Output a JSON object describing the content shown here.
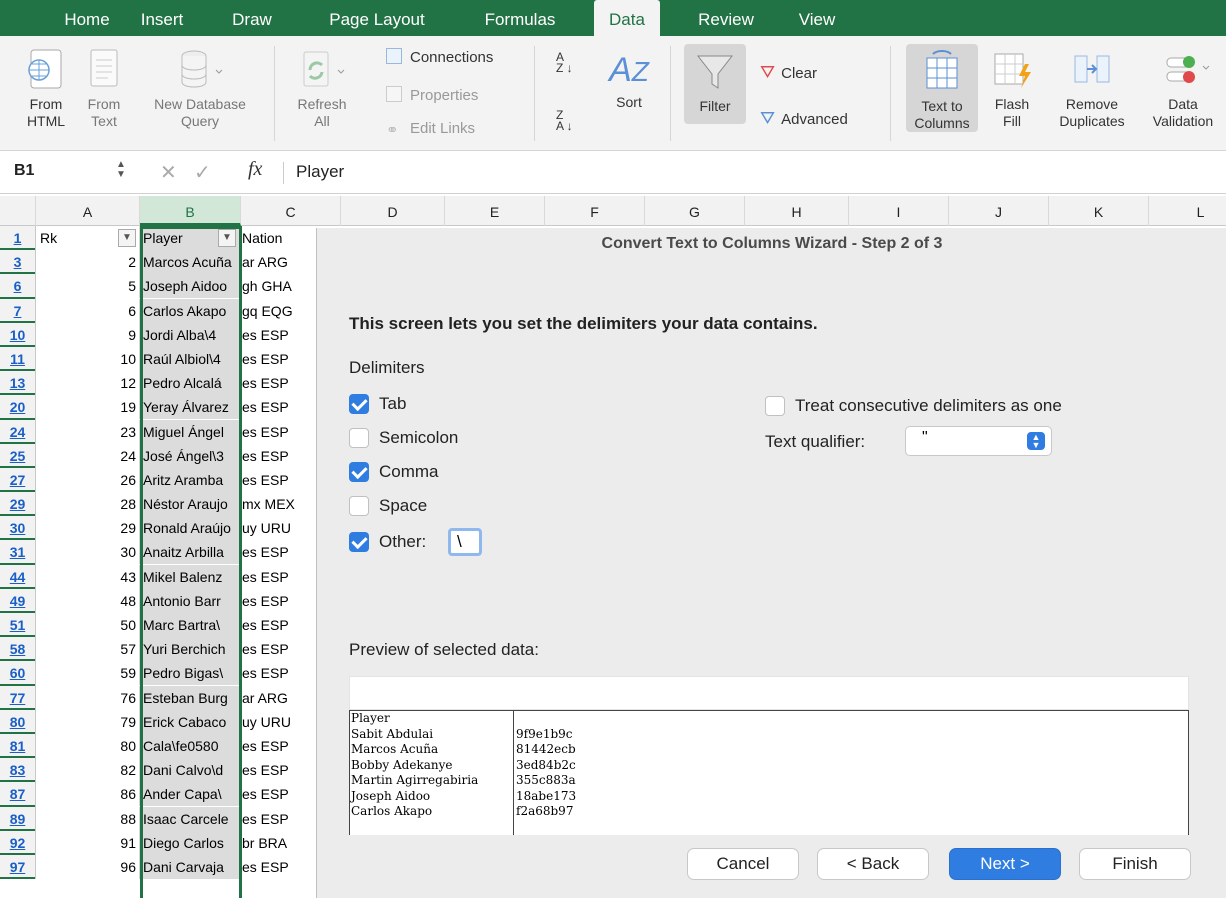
{
  "tabs": [
    "Home",
    "Insert",
    "Draw",
    "Page Layout",
    "Formulas",
    "Data",
    "Review",
    "View"
  ],
  "ribbon": {
    "from_html": [
      "From",
      "HTML"
    ],
    "from_text": [
      "From",
      "Text"
    ],
    "new_db": [
      "New Database",
      "Query"
    ],
    "refresh": [
      "Refresh",
      "All"
    ],
    "connections": "Connections",
    "properties": "Properties",
    "edit_links": "Edit Links",
    "sort": "Sort",
    "filter": "Filter",
    "clear": "Clear",
    "advanced": "Advanced",
    "text_to_columns": [
      "Text to",
      "Columns"
    ],
    "flash_fill": [
      "Flash",
      "Fill"
    ],
    "remove_dup": [
      "Remove",
      "Duplicates"
    ],
    "data_validation": [
      "Data",
      "Validation"
    ]
  },
  "formula_bar": {
    "cell_ref": "B1",
    "fx": "fx",
    "value": "Player"
  },
  "columns": [
    "A",
    "B",
    "C",
    "D",
    "E",
    "F",
    "G",
    "H",
    "I",
    "J",
    "K",
    "L"
  ],
  "rows": [
    {
      "n": "1",
      "a": "Rk",
      "b": "Player",
      "c": "Nation"
    },
    {
      "n": "3",
      "a": "2",
      "b": "Marcos Acuña",
      "c": "ar ARG"
    },
    {
      "n": "6",
      "a": "5",
      "b": "Joseph Aidoo",
      "c": "gh GHA"
    },
    {
      "n": "7",
      "a": "6",
      "b": "Carlos Akapo",
      "c": "gq EQG"
    },
    {
      "n": "10",
      "a": "9",
      "b": "Jordi Alba\\4",
      "c": "es ESP"
    },
    {
      "n": "11",
      "a": "10",
      "b": "Raúl Albiol\\4",
      "c": "es ESP"
    },
    {
      "n": "13",
      "a": "12",
      "b": "Pedro Alcalá",
      "c": "es ESP"
    },
    {
      "n": "20",
      "a": "19",
      "b": "Yeray Álvarez",
      "c": "es ESP"
    },
    {
      "n": "24",
      "a": "23",
      "b": "Miguel Ángel",
      "c": "es ESP"
    },
    {
      "n": "25",
      "a": "24",
      "b": "José Ángel\\3",
      "c": "es ESP"
    },
    {
      "n": "27",
      "a": "26",
      "b": "Aritz Aramba",
      "c": "es ESP"
    },
    {
      "n": "29",
      "a": "28",
      "b": "Néstor Araujo",
      "c": "mx MEX"
    },
    {
      "n": "30",
      "a": "29",
      "b": "Ronald Araújo",
      "c": "uy URU"
    },
    {
      "n": "31",
      "a": "30",
      "b": "Anaitz Arbilla",
      "c": "es ESP"
    },
    {
      "n": "44",
      "a": "43",
      "b": "Mikel Balenz",
      "c": "es ESP"
    },
    {
      "n": "49",
      "a": "48",
      "b": "Antonio Barr",
      "c": "es ESP"
    },
    {
      "n": "51",
      "a": "50",
      "b": "Marc Bartra\\",
      "c": "es ESP"
    },
    {
      "n": "58",
      "a": "57",
      "b": "Yuri Berchich",
      "c": "es ESP"
    },
    {
      "n": "60",
      "a": "59",
      "b": "Pedro Bigas\\",
      "c": "es ESP"
    },
    {
      "n": "77",
      "a": "76",
      "b": "Esteban Burg",
      "c": "ar ARG"
    },
    {
      "n": "80",
      "a": "79",
      "b": "Erick Cabaco",
      "c": "uy URU"
    },
    {
      "n": "81",
      "a": "80",
      "b": "Cala\\fe0580",
      "c": "es ESP"
    },
    {
      "n": "83",
      "a": "82",
      "b": "Dani Calvo\\d",
      "c": "es ESP"
    },
    {
      "n": "87",
      "a": "86",
      "b": "Ander Capa\\",
      "c": "es ESP"
    },
    {
      "n": "89",
      "a": "88",
      "b": "Isaac Carcele",
      "c": "es ESP"
    },
    {
      "n": "92",
      "a": "91",
      "b": "Diego Carlos",
      "c": "br BRA"
    },
    {
      "n": "97",
      "a": "96",
      "b": "Dani Carvaja",
      "c": "es ESP"
    }
  ],
  "dialog": {
    "title": "Convert Text to Columns Wizard - Step 2 of 3",
    "intro": "This screen lets you set the delimiters your data contains.",
    "delimiters_label": "Delimiters",
    "tab": "Tab",
    "semicolon": "Semicolon",
    "comma": "Comma",
    "space": "Space",
    "other": "Other:",
    "other_value": "\\",
    "consecutive": "Treat consecutive delimiters as one",
    "qualifier_label": "Text qualifier:",
    "qualifier_value": "\"",
    "preview_label": "Preview of selected data:",
    "preview_col1": [
      "Player",
      "Sabit Abdulai",
      "Marcos Acuña",
      "Bobby Adekanye",
      "Martin Agirregabiria",
      "Joseph Aidoo",
      "Carlos Akapo"
    ],
    "preview_col2": [
      "",
      "9f9e1b9c",
      "81442ecb",
      "3ed84b2c",
      "355c883a",
      "18abe173",
      "f2a68b97"
    ],
    "cancel": "Cancel",
    "back": "< Back",
    "next": "Next >",
    "finish": "Finish"
  },
  "colors": {
    "excel_green": "#217346",
    "accent_blue": "#2f7de1"
  }
}
